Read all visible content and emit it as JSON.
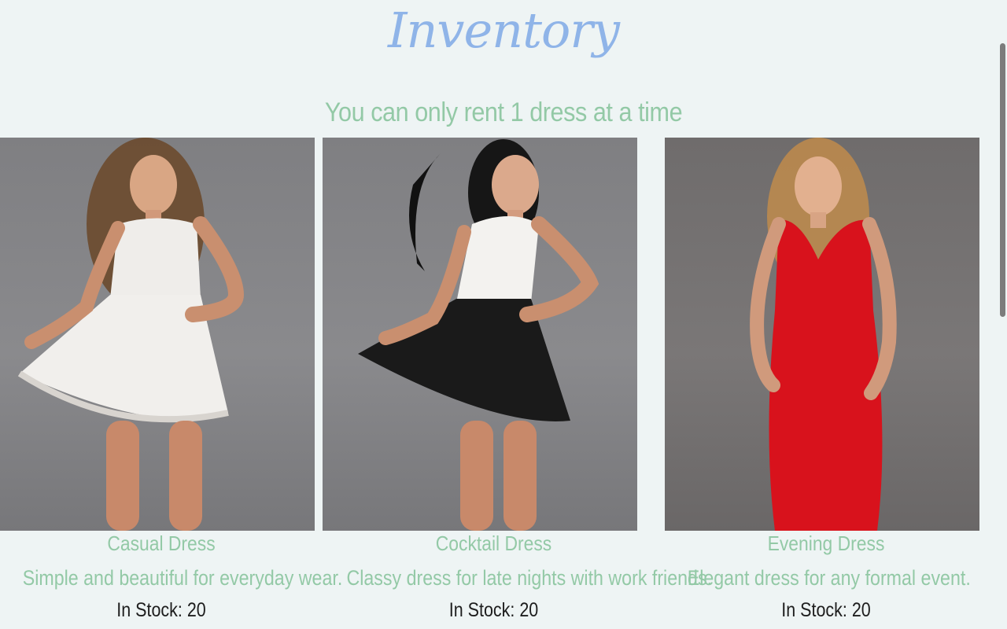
{
  "header": {
    "title": "Inventory",
    "subtitle": "You can only rent 1 dress at a time"
  },
  "colors": {
    "title": "#8fb4e8",
    "accent_green": "#93c9a6",
    "stock_text": "#1d1d1d",
    "background": "#eef4f4"
  },
  "dresses": [
    {
      "name": "Casual Dress",
      "description": "Simple and beautiful for everyday wear.",
      "stock_label": "In Stock:",
      "stock_value": "20",
      "image_subject": "woman in white lace dress",
      "dress_color": "#f1efec"
    },
    {
      "name": "Cocktail Dress",
      "description": "Classy dress for late nights with work friends.",
      "stock_label": "In Stock:",
      "stock_value": "20",
      "image_subject": "woman in white top and black skirt",
      "dress_color": "#1a1a1a"
    },
    {
      "name": "Evening Dress",
      "description": "Elegant dress for any formal event.",
      "stock_label": "In Stock:",
      "stock_value": "20",
      "image_subject": "woman in red lace gown",
      "dress_color": "#d8121c"
    }
  ]
}
